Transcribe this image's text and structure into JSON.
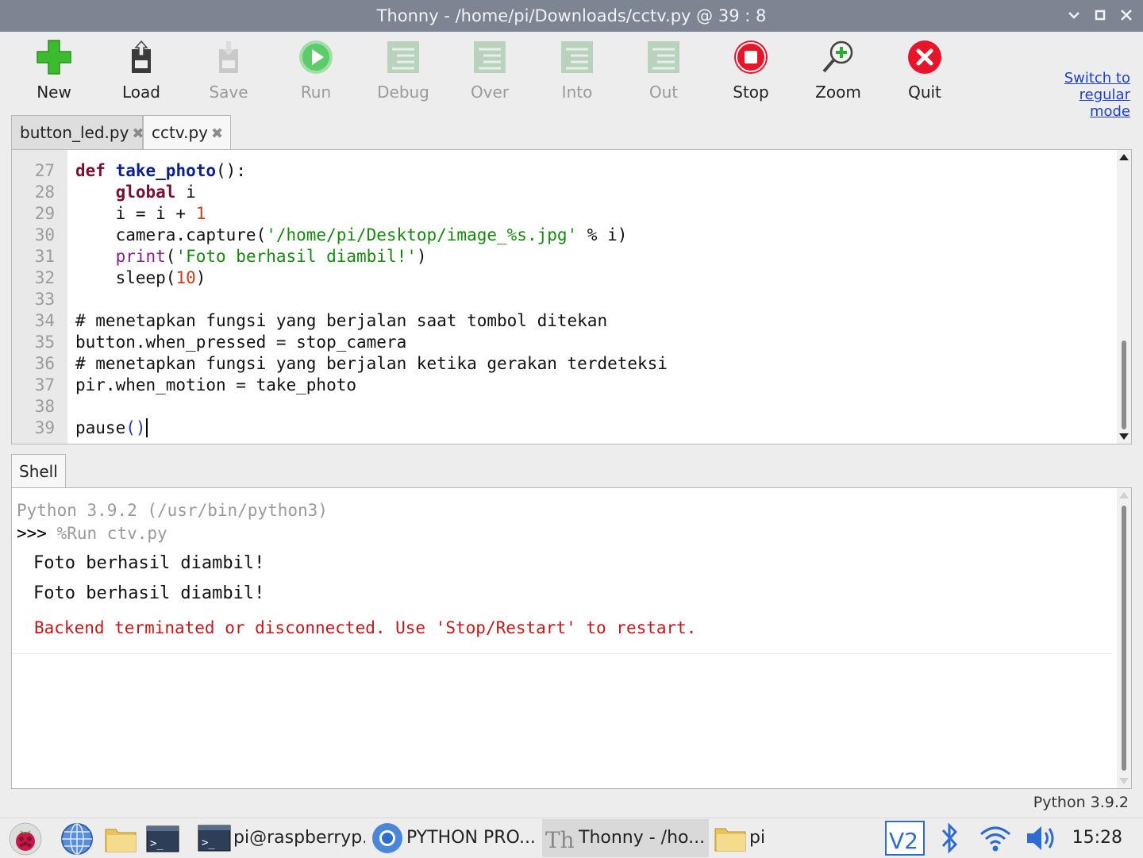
{
  "window": {
    "title": "Thonny  -  /home/pi/Downloads/cctv.py  @  39 : 8",
    "buttons": [
      "minimize-chevron",
      "maximize-square",
      "close-x"
    ]
  },
  "toolbar": {
    "items": [
      {
        "label": "New",
        "icon": "new-plus-icon",
        "enabled": true
      },
      {
        "label": "Load",
        "icon": "load-icon",
        "enabled": true
      },
      {
        "label": "Save",
        "icon": "save-icon",
        "enabled": false
      },
      {
        "label": "Run",
        "icon": "run-icon",
        "enabled": false
      },
      {
        "label": "Debug",
        "icon": "debug-icon",
        "enabled": false
      },
      {
        "label": "Over",
        "icon": "step-over-icon",
        "enabled": false
      },
      {
        "label": "Into",
        "icon": "step-into-icon",
        "enabled": false
      },
      {
        "label": "Out",
        "icon": "step-out-icon",
        "enabled": false
      },
      {
        "label": "Stop",
        "icon": "stop-icon",
        "enabled": true
      },
      {
        "label": "Zoom",
        "icon": "zoom-icon",
        "enabled": true
      },
      {
        "label": "Quit",
        "icon": "quit-icon",
        "enabled": true
      }
    ],
    "switch_mode": [
      "Switch to",
      "regular",
      "mode"
    ]
  },
  "editor": {
    "tabs": [
      {
        "label": "button_led.py",
        "close": "✖",
        "active": false
      },
      {
        "label": "cctv.py",
        "close": "✖",
        "active": true
      }
    ],
    "lines": [
      {
        "n": "27",
        "text": "def take_photo():"
      },
      {
        "n": "28",
        "text": "    global i"
      },
      {
        "n": "29",
        "text": "    i = i + 1"
      },
      {
        "n": "30",
        "text": "    camera.capture('/home/pi/Desktop/image_%s.jpg' % i)"
      },
      {
        "n": "31",
        "text": "    print('Foto berhasil diambil!')"
      },
      {
        "n": "32",
        "text": "    sleep(10)"
      },
      {
        "n": "33",
        "text": ""
      },
      {
        "n": "34",
        "text": "# menetapkan fungsi yang berjalan saat tombol ditekan"
      },
      {
        "n": "35",
        "text": "button.when_pressed = stop_camera"
      },
      {
        "n": "36",
        "text": "# menetapkan fungsi yang berjalan ketika gerakan terdeteksi"
      },
      {
        "n": "37",
        "text": "pir.when_motion = take_photo"
      },
      {
        "n": "38",
        "text": ""
      },
      {
        "n": "39",
        "text": "pause()"
      }
    ]
  },
  "shell": {
    "tab_label": "Shell",
    "version_line": "Python 3.9.2 (/usr/bin/python3)",
    "prompt": ">>>",
    "command": " %Run ctv.py",
    "outputs": [
      "Foto berhasil diambil!",
      "Foto berhasil diambil!"
    ],
    "error": "Backend terminated or disconnected. Use 'Stop/Restart' to restart."
  },
  "status": {
    "interpreter": "Python 3.9.2"
  },
  "taskbar": {
    "launchers": [
      "raspberry-menu-icon",
      "browser-globe-icon",
      "file-manager-icon",
      "terminal-icon"
    ],
    "tasks": [
      {
        "label": "pi@raspberryp...",
        "icon": "terminal-icon",
        "active": false
      },
      {
        "label": "PYTHON PRO...",
        "icon": "chromium-icon",
        "active": false
      },
      {
        "label": "Thonny  -  /ho...",
        "icon": "thonny-icon",
        "active": true
      },
      {
        "label": "pi",
        "icon": "folder-icon",
        "active": false
      }
    ],
    "tray": [
      "vnc-icon",
      "bluetooth-icon",
      "wifi-icon",
      "volume-icon"
    ],
    "clock": "15:28"
  },
  "colors": {
    "titlebar": "#7d8593",
    "keyword": "#7a0f33",
    "function_name": "#0b1f8c",
    "number": "#c4421b",
    "string": "#138a0b",
    "builtin": "#8b1a8b",
    "comment": "#9a9a9a",
    "error": "#c0191b",
    "link": "#1d3fd0"
  }
}
